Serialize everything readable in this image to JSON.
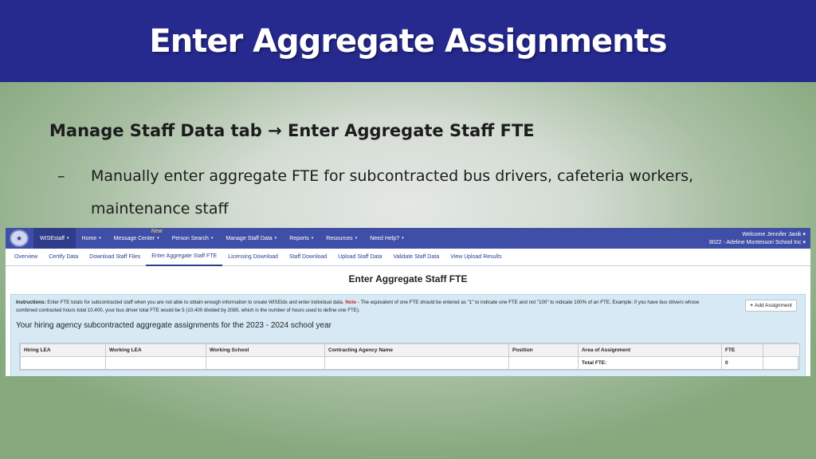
{
  "slide": {
    "title": "Enter Aggregate Assignments",
    "subtitle": "Manage Staff Data tab → Enter Aggregate Staff FTE",
    "bullet_marker": "–",
    "bullet_text": "Manually enter aggregate FTE for subcontracted bus drivers, cafeteria workers, maintenance staff"
  },
  "app": {
    "logo_icon": "wise-globe-logo",
    "nav": [
      {
        "label": "WISEstaff",
        "caret": "▾",
        "active": true
      },
      {
        "label": "Home",
        "caret": "▾"
      },
      {
        "label": "Message Center",
        "caret": "▾",
        "badge": "New"
      },
      {
        "label": "Person Search",
        "caret": "▾"
      },
      {
        "label": "Manage Staff Data",
        "caret": "▾"
      },
      {
        "label": "Reports",
        "caret": "▾"
      },
      {
        "label": "Resources",
        "caret": "▾"
      },
      {
        "label": "Need Help?",
        "caret": "▾"
      }
    ],
    "welcome_line1": "Welcome Jennifer Janik ▾",
    "welcome_line2": "8022 - Adeline Montessori School Inc ▾",
    "subnav": [
      "Overview",
      "Certify Data",
      "Download Staff Files",
      "Enter Aggregate Staff FTE",
      "Licensing Download",
      "Staff Download",
      "Upload Staff Data",
      "Validate Staff Data",
      "View Upload Results"
    ],
    "subnav_active": "Enter Aggregate Staff FTE",
    "page_heading": "Enter Aggregate Staff FTE",
    "instructions_label": "Instructions:",
    "instructions_text": " Enter FTE totals for subcontracted staff when you are not able to obtain enough information to create WISEids and enter individual data. ",
    "note_label": "Note",
    "note_text": " - The equivalent of one FTE should be entered as \"1\" to indicate one FTE and not \"100\" to indicate 100% of an FTE. Example: if you have bus drivers whose combined contracted hours total 10,400, your bus driver total FTE would be 5 (10,400 divided by 2080, which is the number of hours used to define one FTE).",
    "add_button": "Add Assignment",
    "agency_line": "Your hiring agency subcontracted aggregate assignments for the 2023 - 2024 school year",
    "table": {
      "columns": [
        "Hiring LEA",
        "Working LEA",
        "Working School",
        "Contracting Agency Name",
        "Position",
        "Area of Assignment",
        "FTE",
        ""
      ],
      "total_label": "Total FTE:",
      "total_value": "0"
    }
  }
}
